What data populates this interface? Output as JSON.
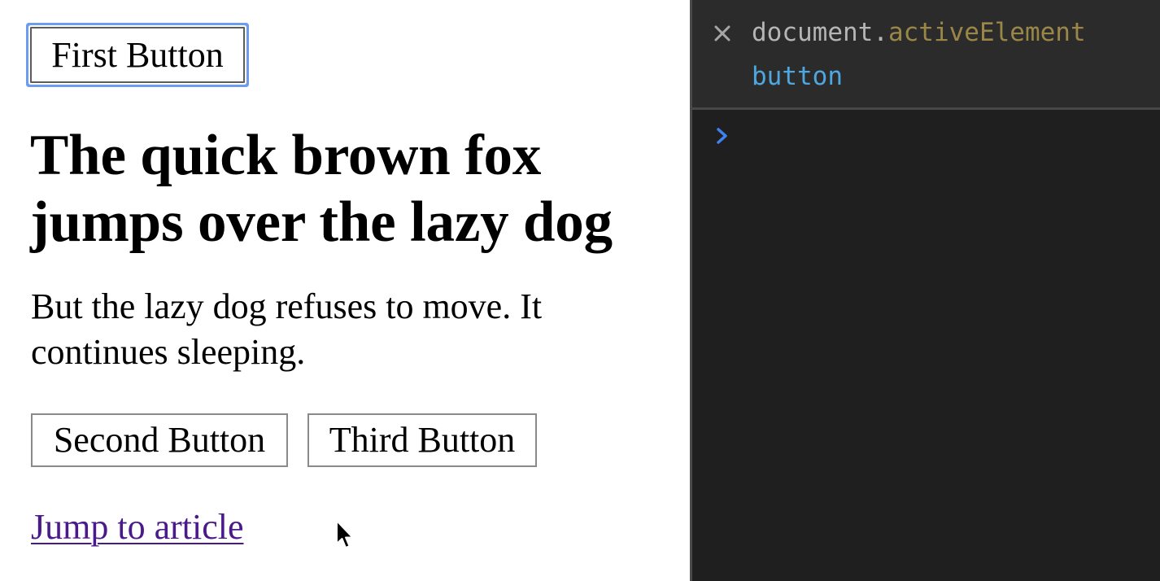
{
  "page": {
    "first_button": "First Button",
    "heading": "The quick brown fox jumps over the lazy dog",
    "paragraph": "But the lazy dog refuses to move. It continues sleeping.",
    "second_button": "Second Button",
    "third_button": "Third Button",
    "link": "Jump to article"
  },
  "console": {
    "expression_object": "document.",
    "expression_property": "activeElement",
    "result": "button",
    "icons": {
      "clear": "close-icon",
      "prompt": "chevron-right-icon"
    }
  },
  "colors": {
    "focus_ring": "#6b9cf0",
    "link": "#4b1a8a",
    "console_bg": "#1f1f1f",
    "console_entry_bg": "#2b2b2b",
    "console_object": "#b5b5b5",
    "console_property": "#9a8748",
    "console_result": "#4fa7e0",
    "console_prompt": "#3d82f0"
  }
}
